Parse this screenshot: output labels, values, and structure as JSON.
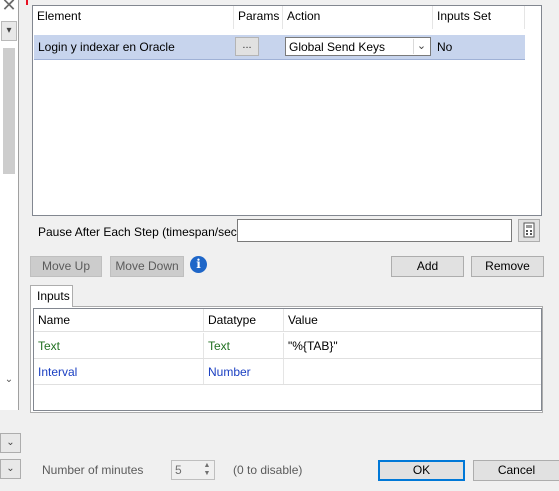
{
  "steps_grid": {
    "columns": [
      "Element",
      "Params",
      "Action",
      "Inputs Set"
    ],
    "rows": [
      {
        "element": "Login  y indexar en Oracle",
        "params": "...",
        "action": "Global Send Keys",
        "inputs_set": "No"
      }
    ]
  },
  "pause": {
    "label": "Pause After Each Step (timespan/secs)",
    "value": ""
  },
  "buttons": {
    "move_up": "Move Up",
    "move_down": "Move Down",
    "add": "Add",
    "remove": "Remove",
    "ok": "OK",
    "cancel": "Cancel"
  },
  "inputs_tab": {
    "tab_label": "Inputs",
    "columns": [
      "Name",
      "Datatype",
      "Value"
    ],
    "rows": [
      {
        "name": "Text",
        "datatype": "Text",
        "value": "\"%{TAB}\"",
        "color": "#207020"
      },
      {
        "name": "Interval",
        "datatype": "Number",
        "value": "",
        "color": "#1a3fc2"
      }
    ]
  },
  "timeout": {
    "label": "Number of minutes",
    "value": "5",
    "hint": "(0 to disable)"
  },
  "icons": [
    "close-icon",
    "chevron-down-icon",
    "calculator-icon",
    "info-icon"
  ],
  "colors": {
    "selection": "#c7d4ed",
    "accent": "#0078d7",
    "info": "#1e66c8"
  }
}
